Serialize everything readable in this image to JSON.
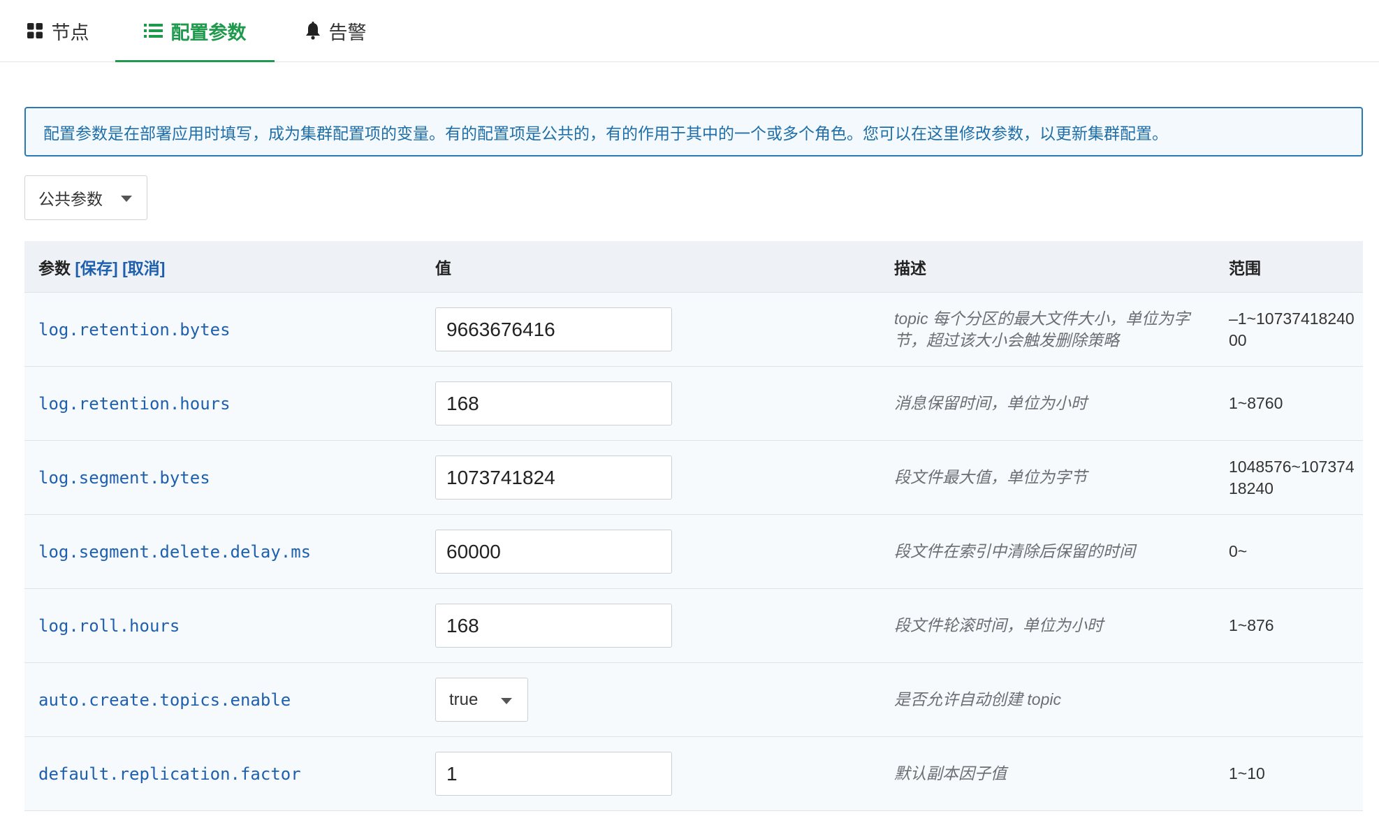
{
  "tabs": [
    {
      "label": "节点",
      "icon": "grid-icon",
      "active": false
    },
    {
      "label": "配置参数",
      "icon": "list-icon",
      "active": true
    },
    {
      "label": "告警",
      "icon": "bell-icon",
      "active": false
    }
  ],
  "colors": {
    "accent": "#1f9a4d",
    "link": "#1e5fae",
    "info_border": "#2a78b6",
    "table_bg": "#f7fafd"
  },
  "alert": {
    "text": "配置参数是在部署应用时填写，成为集群配置项的变量。有的配置项是公共的，有的作用于其中的一个或多个角色。您可以在这里修改参数，以更新集群配置。"
  },
  "scope_select": {
    "value": "公共参数"
  },
  "table": {
    "headers": {
      "param": "参数",
      "save": "[保存]",
      "cancel": "[取消]",
      "value": "值",
      "desc": "描述",
      "range": "范围"
    },
    "rows": [
      {
        "name": "log.retention.bytes",
        "value": "9663676416",
        "type": "input",
        "desc": "topic 每个分区的最大文件大小，单位为字节，超过该大小会触发删除策略",
        "range": "–1~1073741824000"
      },
      {
        "name": "log.retention.hours",
        "value": "168",
        "type": "input",
        "desc": "消息保留时间，单位为小时",
        "range": "1~8760"
      },
      {
        "name": "log.segment.bytes",
        "value": "1073741824",
        "type": "input",
        "desc": "段文件最大值，单位为字节",
        "range": "1048576~10737418240"
      },
      {
        "name": "log.segment.delete.delay.ms",
        "value": "60000",
        "type": "input",
        "desc": "段文件在索引中清除后保留的时间",
        "range": "0~"
      },
      {
        "name": "log.roll.hours",
        "value": "168",
        "type": "input",
        "desc": "段文件轮滚时间，单位为小时",
        "range": "1~876"
      },
      {
        "name": "auto.create.topics.enable",
        "value": "true",
        "type": "select",
        "desc": "是否允许自动创建 topic",
        "range": ""
      },
      {
        "name": "default.replication.factor",
        "value": "1",
        "type": "input",
        "desc": "默认副本因子值",
        "range": "1~10"
      }
    ]
  }
}
